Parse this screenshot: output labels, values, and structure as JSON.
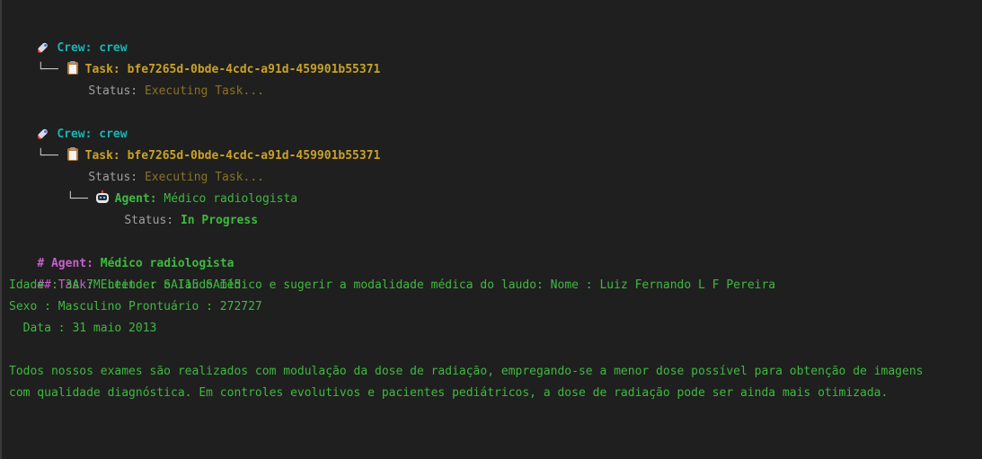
{
  "block1": {
    "crew_label": "Crew:",
    "crew_value": "crew",
    "tree_prefix": "└── ",
    "task_label": "Task:",
    "task_id": "bfe7265d-0bde-4cdc-a91d-459901b55371",
    "status_label": "Status:",
    "status_value": "Executing Task..."
  },
  "block2": {
    "crew_label": "Crew:",
    "crew_value": "crew",
    "tree_prefix": "└── ",
    "task_label": "Task:",
    "task_id": "bfe7265d-0bde-4cdc-a91d-459901b55371",
    "status_label": "Status:",
    "status_value": "Executing Task...",
    "agent_prefix": "└── ",
    "agent_label": "Agent:",
    "agent_value": "Médico radiologista",
    "agent_status_label": "Status:",
    "agent_status_value": "In Progress"
  },
  "output": {
    "agent_heading_label": "# Agent:",
    "agent_heading_value": "Médico radiologista",
    "task_heading_label": "## Task:",
    "task_heading_value": "Entender o laudo médico e sugerir a modalidade médica do laudo: Nome : Luiz Fernando L F Pereira",
    "line_idade": "Idade : 3A 7M Leito : SAI15 SAI15",
    "line_sexo": "Sexo : Masculino Prontuário : 272727",
    "line_data": "  Data : 31 maio 2013",
    "paragraph_line1": "Todos nossos exames são realizados com modulação da dose de radiação, empregando-se a menor dose possível para obtenção de imagens",
    "paragraph_line2": "com qualidade diagnóstica. Em controles evolutivos e pacientes pediátricos, a dose de radiação pode ser ainda mais otimizada."
  },
  "icons": {
    "crew": "rocket-icon",
    "task": "clipboard-icon",
    "agent": "robot-icon"
  },
  "colors": {
    "background": "#1f1f1f",
    "crew": "#19b4b4",
    "task": "#c9a227",
    "status_executing": "#8a7320",
    "agent": "#3fb93f",
    "heading": "#c95fd0",
    "text": "#a0a0a0"
  }
}
